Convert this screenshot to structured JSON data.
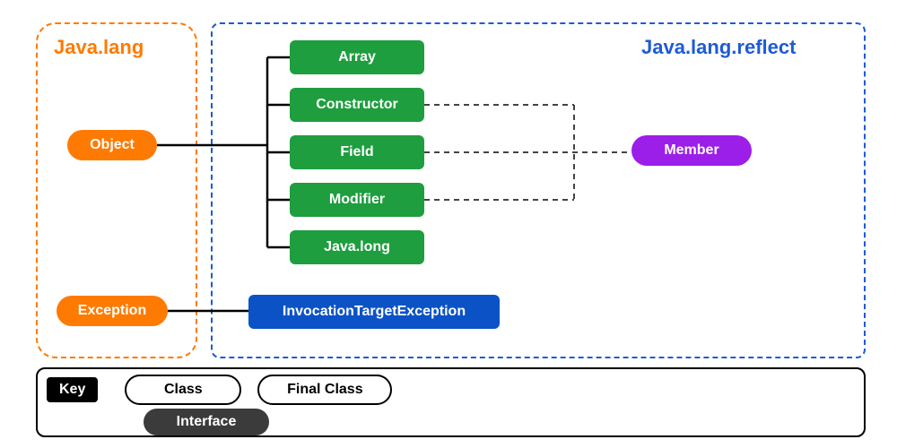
{
  "left_package": {
    "title": "Java.lang"
  },
  "right_package": {
    "title": "Java.lang.reflect"
  },
  "root_nodes": {
    "object": "Object",
    "exception": "Exception"
  },
  "object_children": [
    "Array",
    "Constructor",
    "Field",
    "Modifier",
    "Java.long"
  ],
  "exception_child": "InvocationTargetException",
  "interface_node": "Member",
  "legend": {
    "key_label": "Key",
    "class_label": "Class",
    "final_class_label": "Final Class",
    "interface_label": "Interface"
  },
  "colors": {
    "orange": "#FF7A00",
    "blue": "#1E5BD6",
    "green": "#1E9E3F",
    "blue_rect": "#0B52C7",
    "purple": "#9B1FE8"
  }
}
